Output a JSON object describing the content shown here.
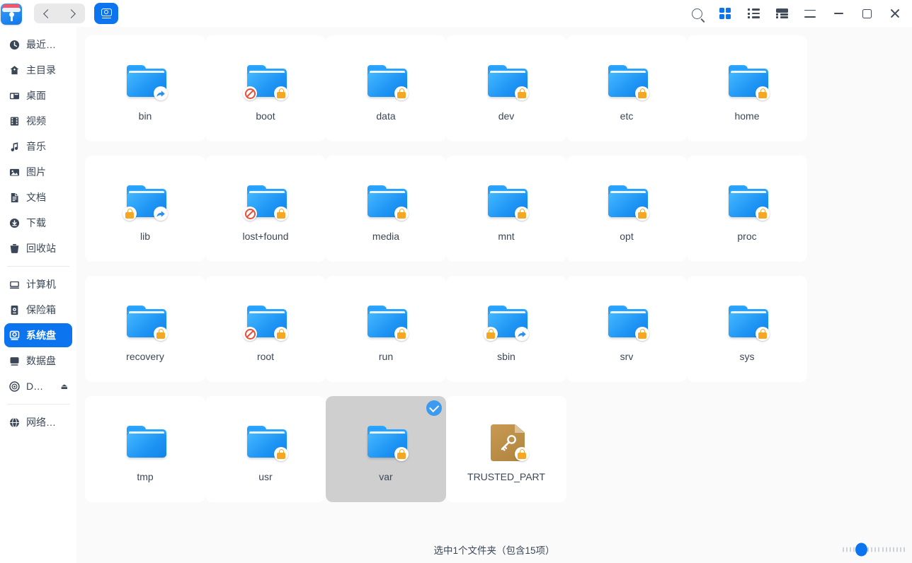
{
  "titlebar": {
    "app_icon": "file-manager-icon",
    "nav": {
      "back": "back-icon",
      "forward": "forward-icon"
    },
    "tab": {
      "name": "system-disk-tab",
      "icon": "disk-icon"
    },
    "tools": [
      {
        "name": "search-button",
        "icon": "search-icon",
        "active": false
      },
      {
        "name": "icon-view-button",
        "icon": "grid-view-icon",
        "active": true
      },
      {
        "name": "list-view-button",
        "icon": "list-view-icon",
        "active": false
      },
      {
        "name": "detail-view-button",
        "icon": "detail-view-icon",
        "active": false
      },
      {
        "name": "menu-button",
        "icon": "hamburger-icon",
        "active": false
      },
      {
        "name": "minimize-button",
        "icon": "minimize-icon",
        "active": false
      },
      {
        "name": "maximize-button",
        "icon": "maximize-icon",
        "active": false
      },
      {
        "name": "close-button",
        "icon": "close-icon",
        "active": false
      }
    ]
  },
  "sidebar": {
    "items": [
      {
        "label": "最近…",
        "icon": "clock-icon",
        "active": false,
        "eject": false
      },
      {
        "label": "主目录",
        "icon": "home-icon",
        "active": false,
        "eject": false
      },
      {
        "label": "桌面",
        "icon": "desktop-icon",
        "active": false,
        "eject": false
      },
      {
        "label": "视频",
        "icon": "video-icon",
        "active": false,
        "eject": false
      },
      {
        "label": "音乐",
        "icon": "music-icon",
        "active": false,
        "eject": false
      },
      {
        "label": "图片",
        "icon": "picture-icon",
        "active": false,
        "eject": false
      },
      {
        "label": "文档",
        "icon": "document-icon",
        "active": false,
        "eject": false
      },
      {
        "label": "下载",
        "icon": "download-icon",
        "active": false,
        "eject": false
      },
      {
        "label": "回收站",
        "icon": "trash-icon",
        "active": false,
        "eject": false
      }
    ],
    "items2": [
      {
        "label": "计算机",
        "icon": "computer-icon",
        "active": false,
        "eject": false
      },
      {
        "label": "保险箱",
        "icon": "safebox-icon",
        "active": false,
        "eject": false
      },
      {
        "label": "系统盘",
        "icon": "system-disk-icon",
        "active": true,
        "eject": false
      },
      {
        "label": "数据盘",
        "icon": "data-disk-icon",
        "active": false,
        "eject": false
      },
      {
        "label": "D…",
        "icon": "optical-disc-icon",
        "active": false,
        "eject": true,
        "eject_glyph": "⏏"
      }
    ],
    "items3": [
      {
        "label": "网络…",
        "icon": "network-icon",
        "active": false,
        "eject": false
      }
    ]
  },
  "files": [
    {
      "name": "bin",
      "type": "folder",
      "badge_left": "none",
      "badge_right": "share",
      "selected": false
    },
    {
      "name": "boot",
      "type": "folder",
      "badge_left": "noaccess",
      "badge_right": "lock",
      "selected": false
    },
    {
      "name": "data",
      "type": "folder",
      "badge_left": "none",
      "badge_right": "lock",
      "selected": false
    },
    {
      "name": "dev",
      "type": "folder",
      "badge_left": "none",
      "badge_right": "lock",
      "selected": false
    },
    {
      "name": "etc",
      "type": "folder",
      "badge_left": "none",
      "badge_right": "lock",
      "selected": false
    },
    {
      "name": "home",
      "type": "folder",
      "badge_left": "none",
      "badge_right": "lock",
      "selected": false
    },
    {
      "name": "lib",
      "type": "folder",
      "badge_left": "lock",
      "badge_right": "share",
      "selected": false
    },
    {
      "name": "lost+found",
      "type": "folder",
      "badge_left": "noaccess",
      "badge_right": "lock",
      "selected": false
    },
    {
      "name": "media",
      "type": "folder",
      "badge_left": "none",
      "badge_right": "lock",
      "selected": false
    },
    {
      "name": "mnt",
      "type": "folder",
      "badge_left": "none",
      "badge_right": "lock",
      "selected": false
    },
    {
      "name": "opt",
      "type": "folder",
      "badge_left": "none",
      "badge_right": "lock",
      "selected": false
    },
    {
      "name": "proc",
      "type": "folder",
      "badge_left": "none",
      "badge_right": "lock",
      "selected": false
    },
    {
      "name": "recovery",
      "type": "folder",
      "badge_left": "none",
      "badge_right": "lock",
      "selected": false
    },
    {
      "name": "root",
      "type": "folder",
      "badge_left": "noaccess",
      "badge_right": "lock",
      "selected": false
    },
    {
      "name": "run",
      "type": "folder",
      "badge_left": "none",
      "badge_right": "lock",
      "selected": false
    },
    {
      "name": "sbin",
      "type": "folder",
      "badge_left": "lock",
      "badge_right": "share",
      "selected": false
    },
    {
      "name": "srv",
      "type": "folder",
      "badge_left": "none",
      "badge_right": "lock",
      "selected": false
    },
    {
      "name": "sys",
      "type": "folder",
      "badge_left": "none",
      "badge_right": "lock",
      "selected": false
    },
    {
      "name": "tmp",
      "type": "folder",
      "badge_left": "none",
      "badge_right": "none",
      "selected": false
    },
    {
      "name": "usr",
      "type": "folder",
      "badge_left": "none",
      "badge_right": "lock",
      "selected": false
    },
    {
      "name": "var",
      "type": "folder",
      "badge_left": "none",
      "badge_right": "lock",
      "selected": true
    },
    {
      "name": "TRUSTED_PART",
      "type": "file",
      "badge_left": "none",
      "badge_right": "lock",
      "selected": false
    }
  ],
  "statusbar": {
    "text": "选中1个文件夹（包含15项）",
    "zoom_slider": {
      "name": "icon-size-slider",
      "value": 30,
      "ticks": 18
    }
  },
  "colors": {
    "accent": "#0c74ef",
    "folder_blue": "#1d93f4",
    "lock_orange": "#f5a623",
    "noaccess_red": "#e8503a",
    "file_tan": "#b0843f",
    "selected_bg": "#cfcfcf",
    "content_bg": "#fafafa",
    "text": "#3b4757"
  }
}
